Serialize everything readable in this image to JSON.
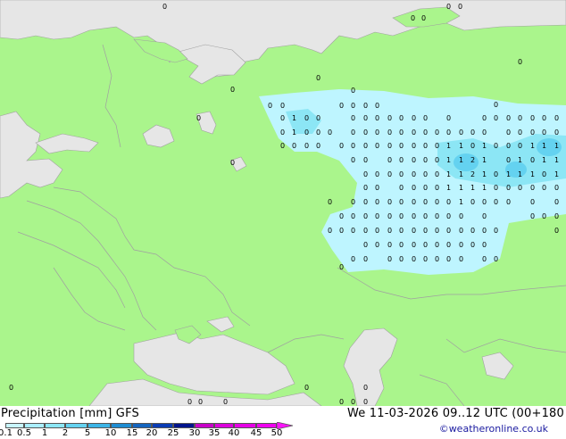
{
  "map": {
    "colors": {
      "land": "#aaf58c",
      "water": "#e6e6e6",
      "light_precip": "#bef5ff",
      "med_precip": "#8ce6f5",
      "border": "#a0a0a0",
      "labels": "#000000"
    },
    "value_labels": [
      "0",
      "1",
      "2"
    ]
  },
  "footer": {
    "title": "Precipitation [mm]  GFS",
    "valid": "We 11-03-2026 09..12 UTC (00+180",
    "credit": "©weatheronline.co.uk"
  },
  "legend": {
    "ticks": [
      "0.1",
      "0.5",
      "1",
      "2",
      "5",
      "10",
      "15",
      "20",
      "25",
      "30",
      "35",
      "40",
      "45",
      "50"
    ],
    "colors": [
      "#ffffff",
      "#c8f5ff",
      "#aaeeff",
      "#8ce6f5",
      "#64d2f0",
      "#3cb4e6",
      "#1e8cd2",
      "#1464be",
      "#0a3cb4",
      "#00148c",
      "#c800c8",
      "#dc00dc",
      "#e600e6",
      "#f000f0",
      "#fa14fa"
    ]
  }
}
